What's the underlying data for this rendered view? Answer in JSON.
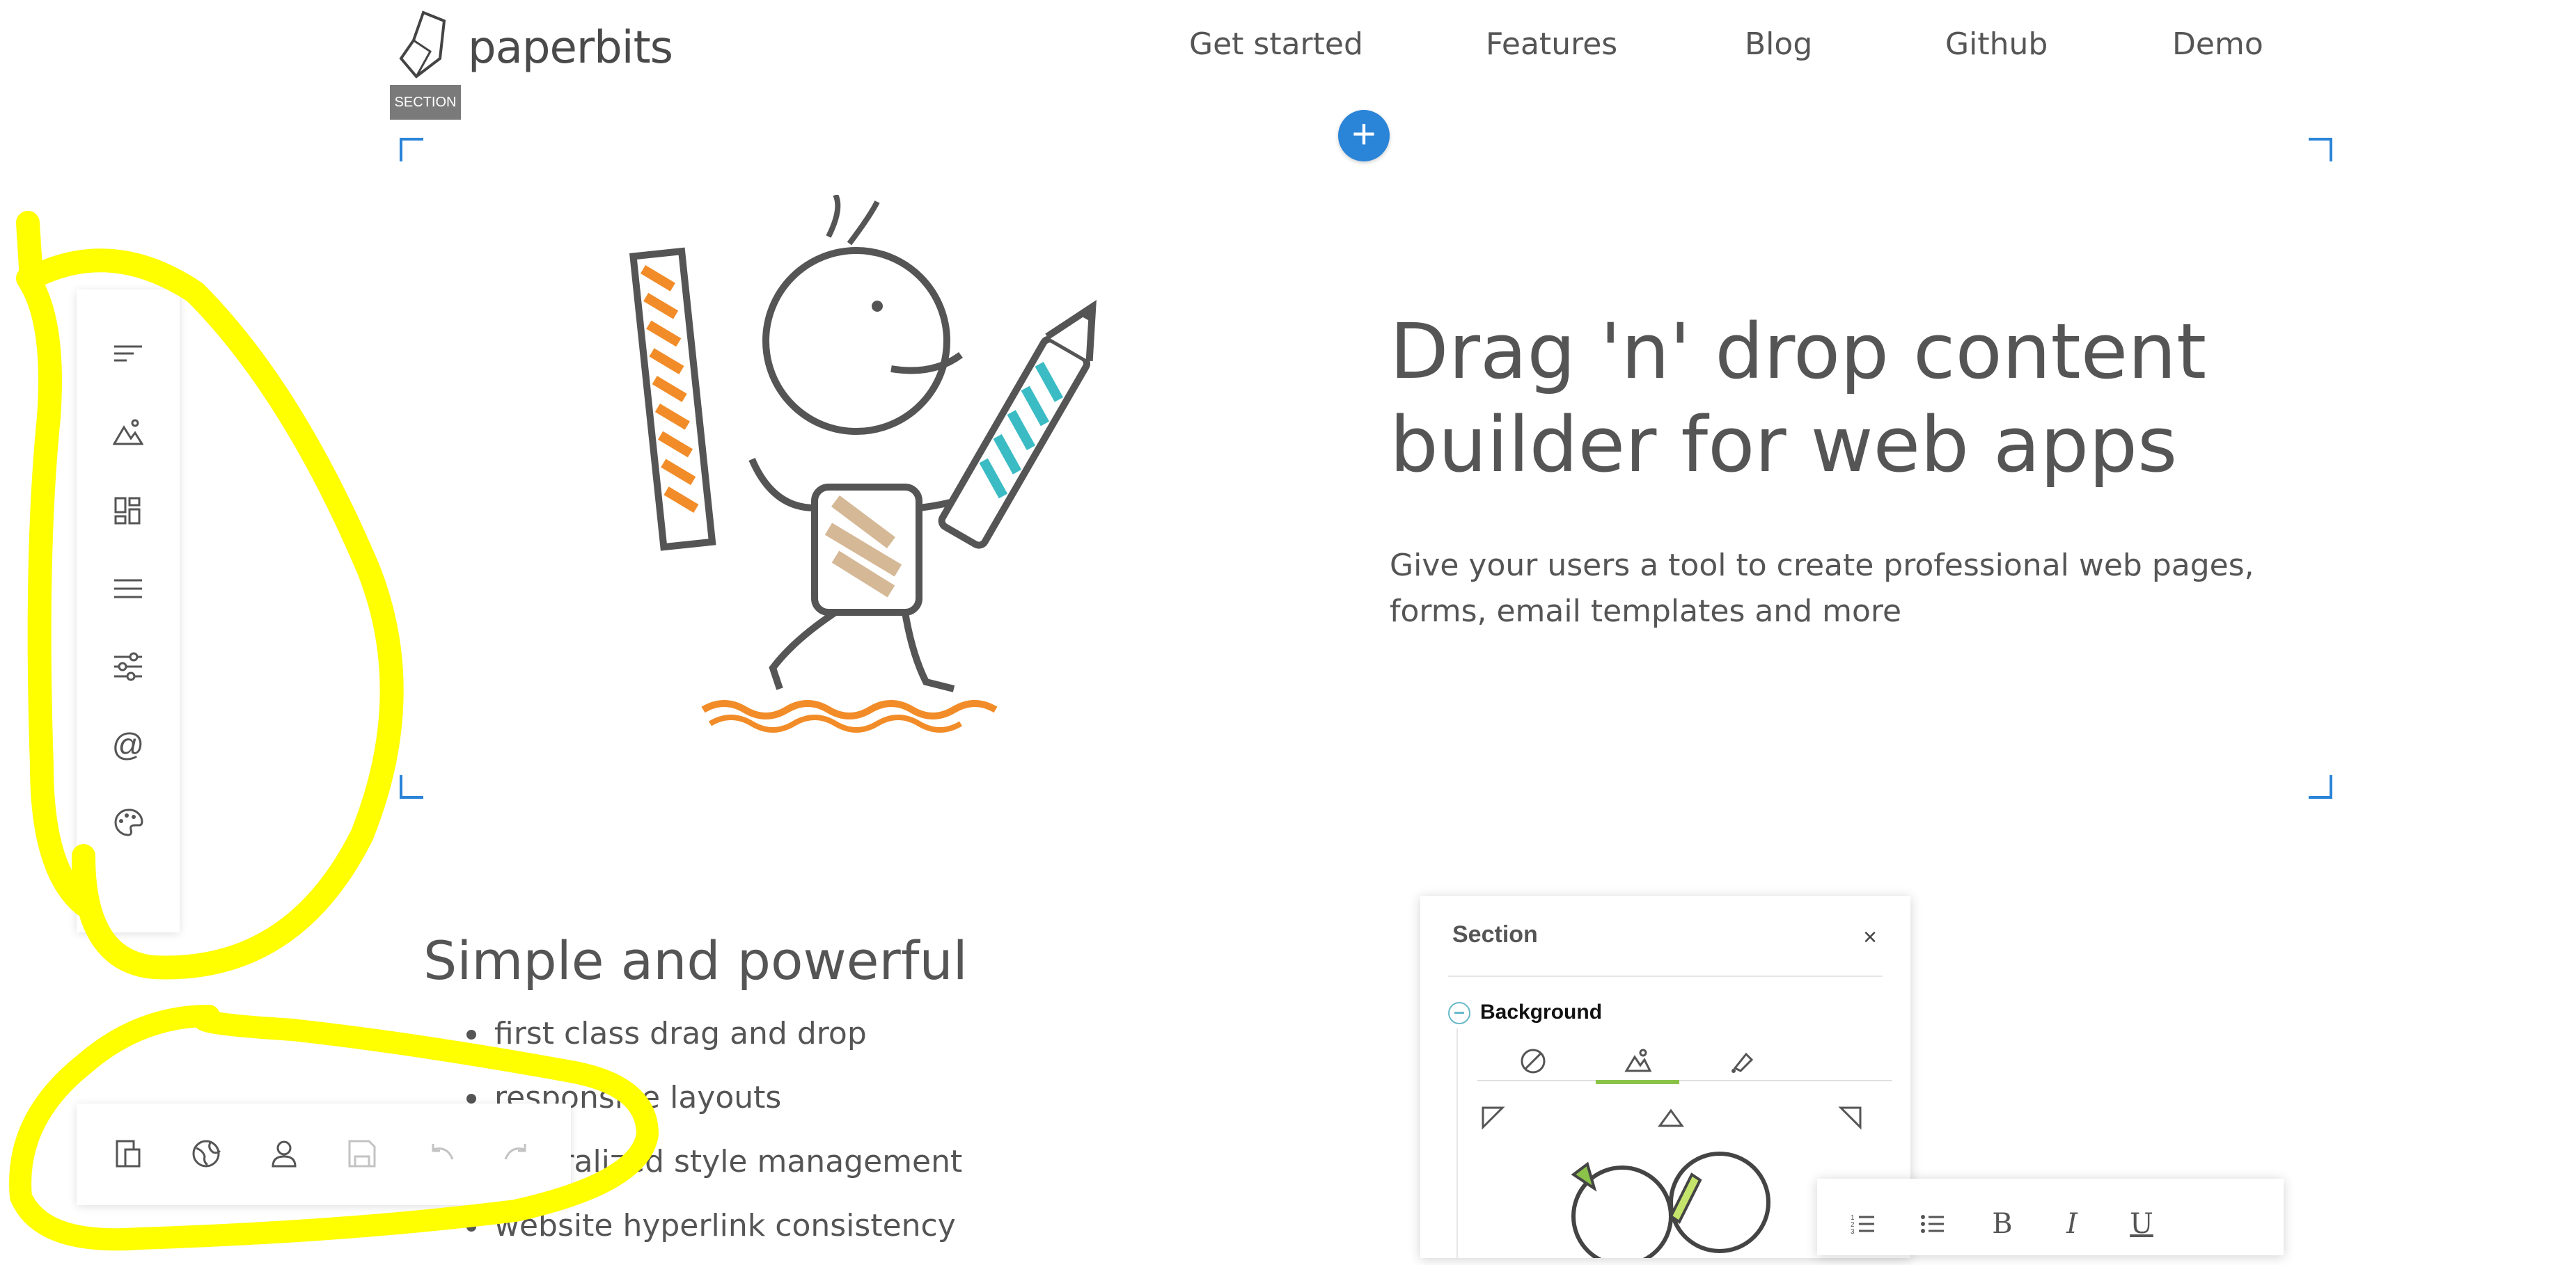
{
  "brand": {
    "name": "paperbits"
  },
  "nav": {
    "items": [
      {
        "label": "Get started"
      },
      {
        "label": "Features"
      },
      {
        "label": "Blog"
      },
      {
        "label": "Github"
      },
      {
        "label": "Demo"
      }
    ]
  },
  "editor": {
    "section_tag": "SECTION",
    "add_icon": "plus-icon"
  },
  "hero": {
    "title_line1": "Drag 'n' drop content",
    "title_line2": "builder for web apps",
    "subtitle_line1": "Give your users a tool to create professional web pages,",
    "subtitle_line2": "forms, email templates and more"
  },
  "features": {
    "title": "Simple and powerful",
    "items": [
      "first class drag and drop",
      "responsive layouts",
      "centralized style management",
      "website hyperlink consistency"
    ]
  },
  "left_toolbar": {
    "icons": [
      "pages-icon",
      "media-icon",
      "widgets-icon",
      "navigation-icon",
      "settings-icon",
      "urls-icon",
      "styles-icon"
    ]
  },
  "bottom_toolbar": {
    "icons": [
      "viewport-icon",
      "globe-icon",
      "user-icon",
      "save-icon",
      "undo-icon",
      "redo-icon"
    ]
  },
  "section_panel": {
    "title": "Section",
    "close": "×",
    "background_label": "Background",
    "tabs": [
      "none-icon",
      "image-icon",
      "color-icon"
    ]
  },
  "format_toolbar": {
    "buttons": [
      "ordered-list-icon",
      "unordered-list-icon",
      "B",
      "I",
      "U"
    ]
  },
  "colors": {
    "accent": "#2a84d8",
    "highlight": "#ffff00",
    "orange": "#f28c28",
    "teal": "#3bbcc4",
    "green": "#8bc34a"
  }
}
